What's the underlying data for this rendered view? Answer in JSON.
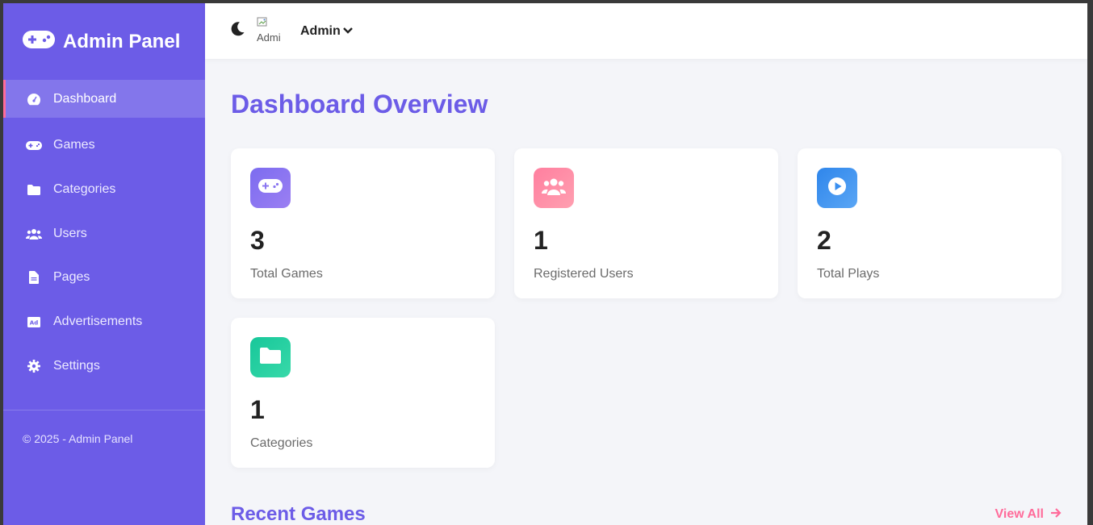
{
  "brand": {
    "title": "Admin Panel"
  },
  "sidebar": {
    "items": [
      {
        "label": "Dashboard",
        "icon": "dashboard-icon",
        "active": true
      },
      {
        "label": "Games",
        "icon": "gamepad-icon"
      },
      {
        "label": "Categories",
        "icon": "folder-icon"
      },
      {
        "label": "Users",
        "icon": "users-icon"
      },
      {
        "label": "Pages",
        "icon": "file-icon"
      },
      {
        "label": "Advertisements",
        "icon": "ad-icon"
      },
      {
        "label": "Settings",
        "icon": "gear-icon"
      }
    ],
    "footer": "© 2025 - Admin Panel"
  },
  "topbar": {
    "avatar_alt": "Admi",
    "user_label": "Admin"
  },
  "main": {
    "title": "Dashboard Overview",
    "stats": [
      {
        "value": "3",
        "label": "Total Games",
        "icon": "gamepad-icon",
        "color_from": "#7c6cf0",
        "color_to": "#9b7ff2"
      },
      {
        "value": "1",
        "label": "Registered Users",
        "icon": "users-icon",
        "color_from": "#ff7f9f",
        "color_to": "#ff9fb0"
      },
      {
        "value": "2",
        "label": "Total Plays",
        "icon": "play-icon",
        "color_from": "#2f86eb",
        "color_to": "#5aa6f5"
      },
      {
        "value": "1",
        "label": "Categories",
        "icon": "folder-icon",
        "color_from": "#17c79a",
        "color_to": "#38d9a9"
      }
    ],
    "recent_games": {
      "title": "Recent Games",
      "view_all": "View All"
    }
  },
  "colors": {
    "sidebar_bg": "#6c5ce7",
    "accent": "#6c5ce7",
    "active_border": "#ff6b9a",
    "link": "#ff6b9a"
  }
}
